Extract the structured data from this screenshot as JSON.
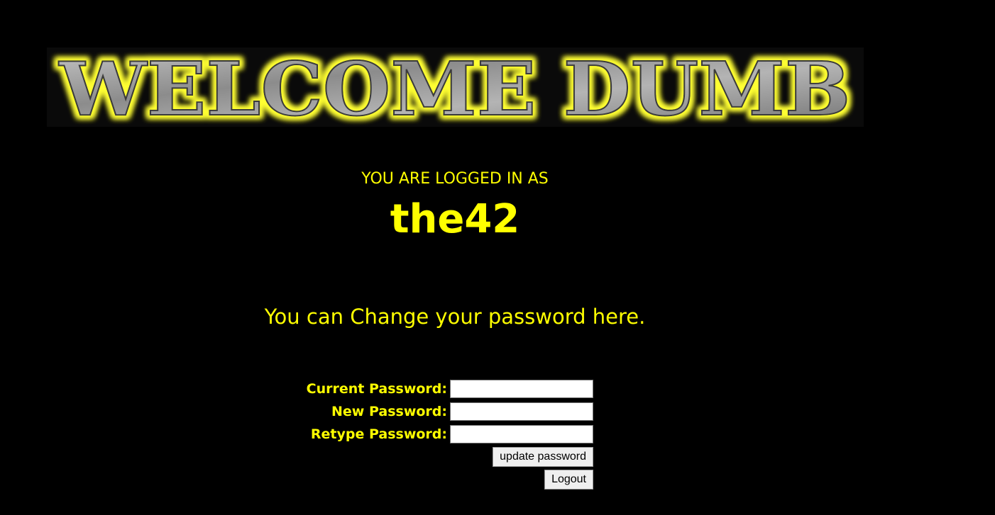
{
  "banner": {
    "text": "WELCOME DUMB",
    "glow_color": "#ffff33",
    "letter_color": "#9a9a9a"
  },
  "session": {
    "logged_in_label": "YOU ARE LOGGED IN AS",
    "username": "the42"
  },
  "change_message": "You can Change your password here.",
  "form": {
    "current_label": "Current Password:",
    "current_value": "",
    "new_label": "New Password:",
    "new_value": "",
    "retype_label": "Retype Password:",
    "retype_value": "",
    "update_button": "update password",
    "logout_button": "Logout"
  },
  "colors": {
    "background": "#000000",
    "text": "#ffff00"
  }
}
